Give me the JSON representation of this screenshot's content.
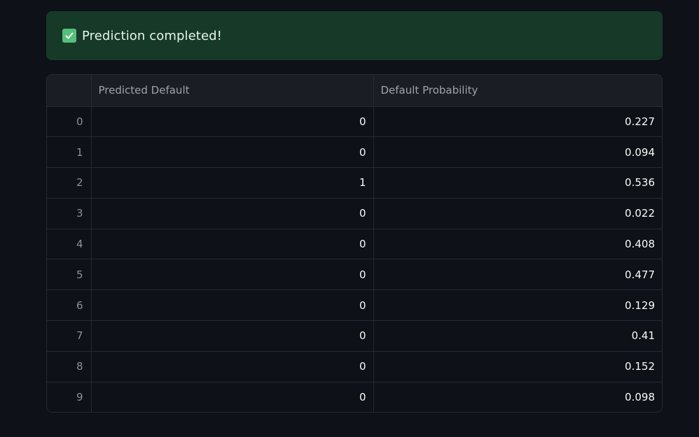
{
  "alert": {
    "message": "Prediction completed!",
    "icon": "white-check-mark-icon",
    "background": "#173928",
    "icon_color": "#55c07a"
  },
  "table": {
    "columns": [
      "",
      "Predicted Default",
      "Default Probability"
    ],
    "rows": [
      {
        "index": "0",
        "predicted_default": "0",
        "default_probability": "0.227"
      },
      {
        "index": "1",
        "predicted_default": "0",
        "default_probability": "0.094"
      },
      {
        "index": "2",
        "predicted_default": "1",
        "default_probability": "0.536"
      },
      {
        "index": "3",
        "predicted_default": "0",
        "default_probability": "0.022"
      },
      {
        "index": "4",
        "predicted_default": "0",
        "default_probability": "0.408"
      },
      {
        "index": "5",
        "predicted_default": "0",
        "default_probability": "0.477"
      },
      {
        "index": "6",
        "predicted_default": "0",
        "default_probability": "0.129"
      },
      {
        "index": "7",
        "predicted_default": "0",
        "default_probability": "0.41"
      },
      {
        "index": "8",
        "predicted_default": "0",
        "default_probability": "0.152"
      },
      {
        "index": "9",
        "predicted_default": "0",
        "default_probability": "0.098"
      }
    ]
  }
}
